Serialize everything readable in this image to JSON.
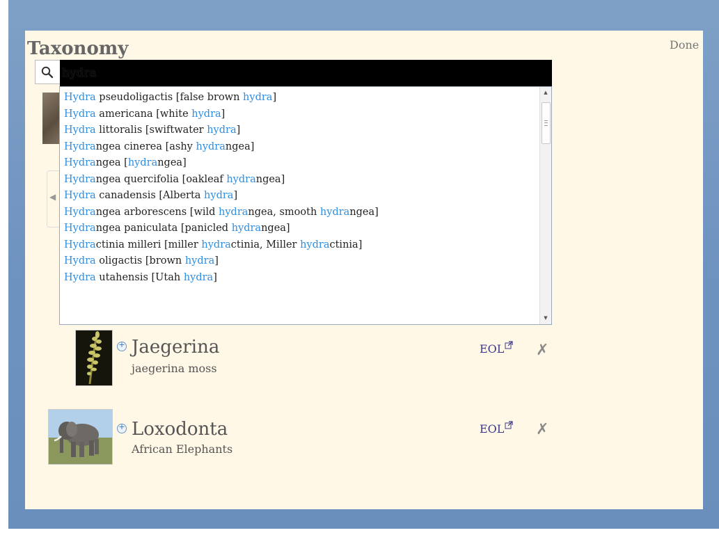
{
  "header": {
    "title": "Taxonomy",
    "done_label": "Done"
  },
  "search": {
    "value": "hydra",
    "icon": "search-icon"
  },
  "suggestions": [
    [
      {
        "t": "Hydra",
        "h": true
      },
      {
        "t": " pseudoligactis [false brown ",
        "h": false
      },
      {
        "t": "hydra",
        "h": true
      },
      {
        "t": "]",
        "h": false
      }
    ],
    [
      {
        "t": "Hydra",
        "h": true
      },
      {
        "t": " americana [white ",
        "h": false
      },
      {
        "t": "hydra",
        "h": true
      },
      {
        "t": "]",
        "h": false
      }
    ],
    [
      {
        "t": "Hydra",
        "h": true
      },
      {
        "t": " littoralis [swiftwater ",
        "h": false
      },
      {
        "t": "hydra",
        "h": true
      },
      {
        "t": "]",
        "h": false
      }
    ],
    [
      {
        "t": "Hydra",
        "h": true
      },
      {
        "t": "ngea cinerea [ashy ",
        "h": false
      },
      {
        "t": "hydra",
        "h": true
      },
      {
        "t": "ngea]",
        "h": false
      }
    ],
    [
      {
        "t": "Hydra",
        "h": true
      },
      {
        "t": "ngea [",
        "h": false
      },
      {
        "t": "hydra",
        "h": true
      },
      {
        "t": "ngea]",
        "h": false
      }
    ],
    [
      {
        "t": "Hydra",
        "h": true
      },
      {
        "t": "ngea quercifolia [oakleaf ",
        "h": false
      },
      {
        "t": "hydra",
        "h": true
      },
      {
        "t": "ngea]",
        "h": false
      }
    ],
    [
      {
        "t": "Hydra",
        "h": true
      },
      {
        "t": " canadensis [Alberta ",
        "h": false
      },
      {
        "t": "hydra",
        "h": true
      },
      {
        "t": "]",
        "h": false
      }
    ],
    [
      {
        "t": "Hydra",
        "h": true
      },
      {
        "t": "ngea arborescens [wild ",
        "h": false
      },
      {
        "t": "hydra",
        "h": true
      },
      {
        "t": "ngea, smooth ",
        "h": false
      },
      {
        "t": "hydra",
        "h": true
      },
      {
        "t": "ngea]",
        "h": false
      }
    ],
    [
      {
        "t": "Hydra",
        "h": true
      },
      {
        "t": "ngea paniculata [panicled ",
        "h": false
      },
      {
        "t": "hydra",
        "h": true
      },
      {
        "t": "ngea]",
        "h": false
      }
    ],
    [
      {
        "t": "Hydra",
        "h": true
      },
      {
        "t": "ctinia milleri [miller ",
        "h": false
      },
      {
        "t": "hydra",
        "h": true
      },
      {
        "t": "ctinia, Miller ",
        "h": false
      },
      {
        "t": "hydra",
        "h": true
      },
      {
        "t": "ctinia]",
        "h": false
      }
    ],
    [
      {
        "t": "Hydra",
        "h": true
      },
      {
        "t": " oligactis [brown ",
        "h": false
      },
      {
        "t": "hydra",
        "h": true
      },
      {
        "t": "]",
        "h": false
      }
    ],
    [
      {
        "t": "Hydra",
        "h": true
      },
      {
        "t": " utahensis [Utah ",
        "h": false
      },
      {
        "t": "hydra",
        "h": true
      },
      {
        "t": "]",
        "h": false
      }
    ]
  ],
  "taxa": [
    {
      "name": "Jaegerina",
      "common": "jaegerina moss",
      "link": "EOL",
      "remove": "✗"
    },
    {
      "name": "Loxodonta",
      "common": "African Elephants",
      "link": "EOL",
      "remove": "✗"
    }
  ],
  "colors": {
    "highlight": "#2f8ee0",
    "link": "#3d3a8c",
    "panel": "#fff8e6",
    "frame": "#7196c2"
  }
}
